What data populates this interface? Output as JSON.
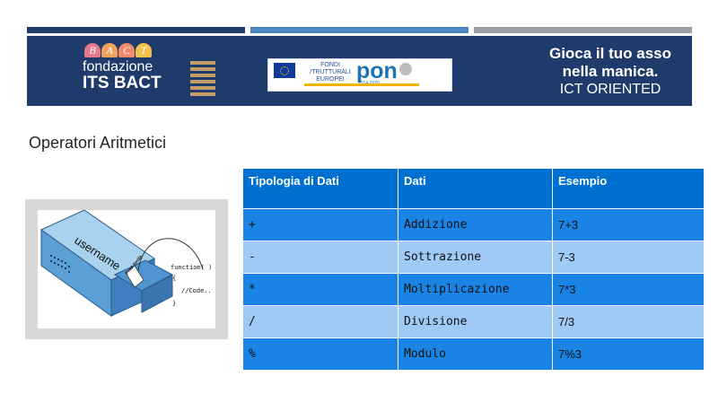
{
  "banner": {
    "logo": {
      "letters": [
        "B",
        "A",
        "C",
        "T"
      ],
      "line1": "fondazione",
      "line2": "ITS BACT"
    },
    "fondi_logo": {
      "line1": "FONDI",
      "line2": "/TRUTTURALI",
      "line3": "EUROPEI",
      "pon": "pon",
      "years": "2014-2020"
    },
    "slogan": {
      "line1": "Gioca il tuo asso",
      "line2": "nella manica.",
      "line3": "ICT ORIENTED"
    }
  },
  "title": "Operatori Aritmetici",
  "illustration": {
    "label_box": "username",
    "label_tag": "Fred Smith",
    "code_line1": "function(  )",
    "code_line2": "{",
    "code_line3": "//Code..",
    "code_line4": "}"
  },
  "table": {
    "headers": [
      "Tipologia di Dati",
      "Dati",
      "Esempio"
    ],
    "rows": [
      [
        "+",
        "Addizione",
        "7+3"
      ],
      [
        "-",
        "Sottrazione",
        "7-3"
      ],
      [
        "*",
        "Moltiplicazione",
        "7*3"
      ],
      [
        "/",
        "Divisione",
        "7/3"
      ],
      [
        "%",
        "Modulo",
        "7%3"
      ]
    ]
  },
  "colors": {
    "banner_bg": "#1f3b6b",
    "table_header": "#0070d0",
    "row_dark": "#1a83e6",
    "row_light": "#9fcaf5"
  }
}
